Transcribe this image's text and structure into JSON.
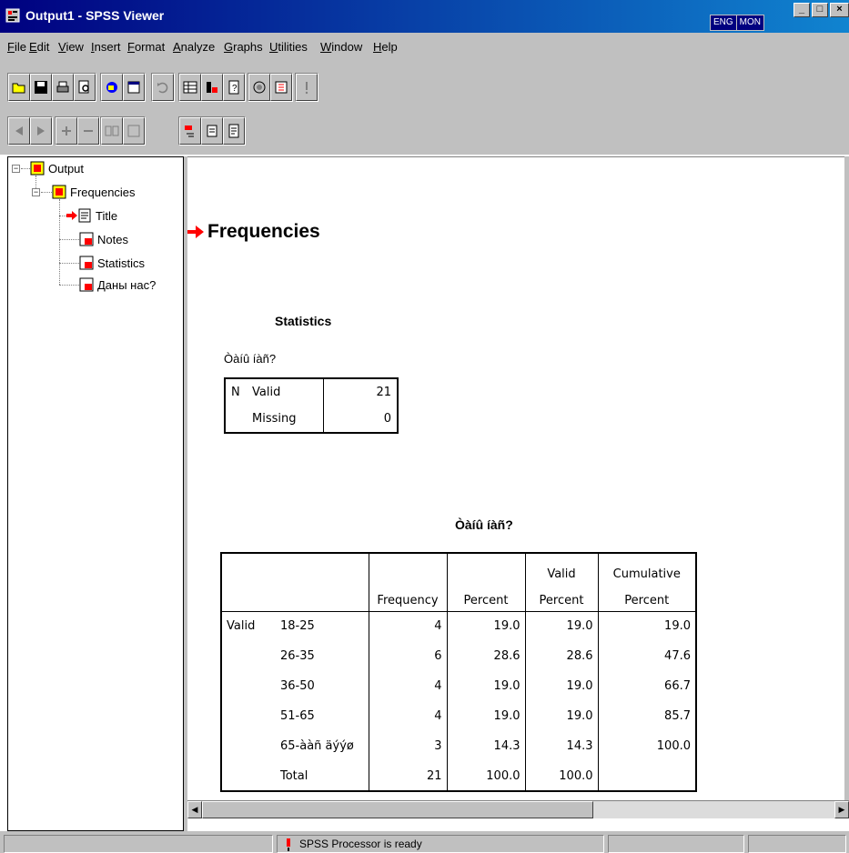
{
  "window": {
    "title": "Output1 - SPSS Viewer",
    "lang_indicators": [
      "ENG",
      "MON"
    ],
    "controls": [
      "_",
      "□",
      "×"
    ]
  },
  "menu": [
    "File",
    "Edit",
    "View",
    "Insert",
    "Format",
    "Analyze",
    "Graphs",
    "Utilities",
    "Window",
    "Help"
  ],
  "toolbar1": [
    "open-icon",
    "save-icon",
    "print-icon",
    "print-preview-icon",
    "export-icon",
    "dialog-recall-icon",
    "undo-icon",
    "goto-data-icon",
    "variables-icon",
    "info-icon",
    "use-sets-icon",
    "select-cases-icon",
    "run-icon"
  ],
  "toolbar2": [
    "promote-icon",
    "demote-icon",
    "expand-icon",
    "collapse-icon",
    "show-icon",
    "hide-icon",
    "insert-heading-icon",
    "insert-title-icon",
    "insert-text-icon"
  ],
  "outline": {
    "root": "Output",
    "child": "Frequencies",
    "items": [
      "Title",
      "Notes",
      "Statistics",
      "Даны нас?"
    ]
  },
  "content": {
    "heading": "Frequencies",
    "stats": {
      "title": "Statistics",
      "caption": "Òàíû íàñ?",
      "group": "N",
      "rows": [
        {
          "label": "Valid",
          "value": "21"
        },
        {
          "label": "Missing",
          "value": "0"
        }
      ]
    },
    "freq": {
      "title": "Òàíû íàñ?",
      "headers": {
        "h1": "Frequency",
        "h2": "Percent",
        "h3a": "Valid",
        "h3b": "Percent",
        "h4a": "Cumulative",
        "h4b": "Percent"
      },
      "group": "Valid",
      "rows": [
        {
          "label": "18-25",
          "freq": "4",
          "pct": "19.0",
          "vpct": "19.0",
          "cpct": "19.0"
        },
        {
          "label": "26-35",
          "freq": "6",
          "pct": "28.6",
          "vpct": "28.6",
          "cpct": "47.6"
        },
        {
          "label": "36-50",
          "freq": "4",
          "pct": "19.0",
          "vpct": "19.0",
          "cpct": "66.7"
        },
        {
          "label": "51-65",
          "freq": "4",
          "pct": "19.0",
          "vpct": "19.0",
          "cpct": "85.7"
        },
        {
          "label": "65-ààñ äýýø",
          "freq": "3",
          "pct": "14.3",
          "vpct": "14.3",
          "cpct": "100.0"
        },
        {
          "label": "Total",
          "freq": "21",
          "pct": "100.0",
          "vpct": "100.0",
          "cpct": ""
        }
      ]
    }
  },
  "status": {
    "text": "SPSS Processor  is ready"
  }
}
